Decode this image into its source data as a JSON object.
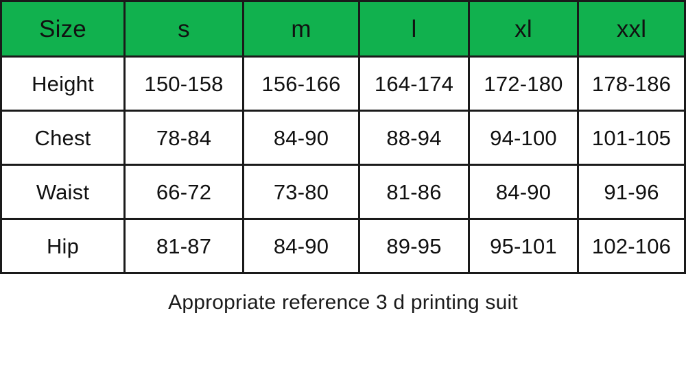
{
  "table": {
    "columns": [
      "Size",
      "s",
      "m",
      "l",
      "xl",
      "xxl"
    ],
    "header_bg": "#11b14e",
    "header_text_color": "#111111",
    "border_color": "#1a1a1a",
    "rows": [
      {
        "label": "Height",
        "values": [
          "150-158",
          "156-166",
          "164-174",
          "172-180",
          "178-186"
        ]
      },
      {
        "label": "Chest",
        "values": [
          "78-84",
          "84-90",
          "88-94",
          "94-100",
          "101-105"
        ]
      },
      {
        "label": "Waist",
        "values": [
          "66-72",
          "73-80",
          "81-86",
          "84-90",
          "91-96"
        ]
      },
      {
        "label": "Hip",
        "values": [
          "81-87",
          "84-90",
          "89-95",
          "95-101",
          "102-106"
        ]
      }
    ]
  },
  "caption": {
    "text": "Appropriate reference 3 d printing suit"
  }
}
